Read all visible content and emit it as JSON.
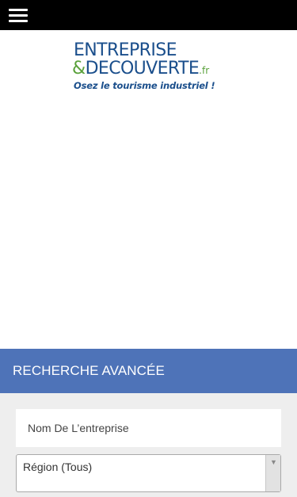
{
  "nav": {
    "menu_icon": "hamburger-menu-icon"
  },
  "logo": {
    "line1": "ENTREPRISE",
    "amp": "&",
    "line2": "DECOUVERTE",
    "suffix": ".fr",
    "tagline": "Osez le tourisme industriel !"
  },
  "search": {
    "title": "RECHERCHE AVANCÉE",
    "name_placeholder": "Nom De L’entreprise",
    "name_value": "",
    "region_selected": "Région (Tous)",
    "region_arrow": "▼"
  },
  "colors": {
    "topbar": "#000000",
    "logo_blue": "#1b4f8c",
    "logo_green": "#5aa13b",
    "search_header": "#4e73b8",
    "search_background": "#eeeeee"
  }
}
